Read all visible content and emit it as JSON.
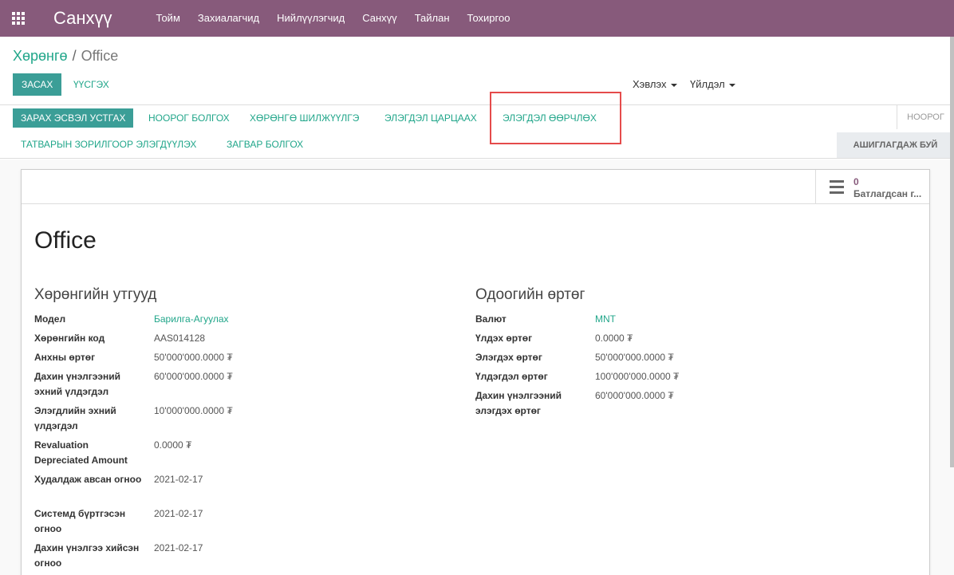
{
  "navbar": {
    "brand": "Санхүү",
    "menu": [
      "Тойм",
      "Захиалагчид",
      "Нийлүүлэгчид",
      "Санхүү",
      "Тайлан",
      "Тохиргоо"
    ]
  },
  "breadcrumb": {
    "parent": "Хөрөнгө",
    "separator": "/",
    "current": "Office"
  },
  "control": {
    "edit_label": "ЗАСАХ",
    "create_label": "ҮҮСГЭХ",
    "print_label": "Хэвлэх",
    "action_label": "Үйлдэл"
  },
  "statusbar": {
    "buttons": [
      "ЗАРАХ ЭСВЭЛ УСТГАХ",
      "НООРОГ БОЛГОХ",
      "ХӨРӨНГӨ ШИЛЖҮҮЛГЭ",
      "ЭЛЭГДЭЛ ЦАРЦААХ",
      "ЭЛЭГДЭЛ ӨӨРЧЛӨХ",
      "ТАТВАРЫН ЗОРИЛГООР ЭЛЭГДҮҮЛЭХ",
      "ЗАГВАР БОЛГОХ"
    ],
    "state_draft": "НООРОГ",
    "state_active": "АШИГЛАГДАЖ БУЙ"
  },
  "smart_button": {
    "value": "0",
    "label": "Батлагдсан г..."
  },
  "record": {
    "title": "Office"
  },
  "left_group": {
    "title": "Хөрөнгийн утгууд",
    "fields": [
      {
        "label": "Модел",
        "value": "Барилга-Агуулах"
      },
      {
        "label": "Хөрөнгийн код",
        "value": "AAS014128"
      },
      {
        "label": "Анхны өртөг",
        "value": "50'000'000.0000 ₮"
      },
      {
        "label": "Дахин үнэлгээний эхний үлдэгдэл",
        "value": "60'000'000.0000 ₮"
      },
      {
        "label": "Элэгдлийн эхний үлдэгдэл",
        "value": "10'000'000.0000 ₮"
      },
      {
        "label": "Revaluation Depreciated Amount",
        "value": "0.0000 ₮"
      },
      {
        "label": "Худалдаж авсан огноо",
        "value": "2021-02-17"
      },
      {
        "label": "Системд бүртгэсэн огноо",
        "value": "2021-02-17"
      },
      {
        "label": "Дахин үнэлгээ хийсэн огноо",
        "value": "2021-02-17"
      }
    ]
  },
  "right_group": {
    "title": "Одоогийн өртөг",
    "fields": [
      {
        "label": "Валют",
        "value": "MNT"
      },
      {
        "label": "Үлдэх өртөг",
        "value": "0.0000 ₮"
      },
      {
        "label": "Элэгдэх өртөг",
        "value": "50'000'000.0000 ₮"
      },
      {
        "label": "Үлдэгдэл өртөг",
        "value": "100'000'000.0000 ₮"
      },
      {
        "label": "Дахин үнэлгээний элэгдэх өртөг",
        "value": "60'000'000.0000 ₮"
      }
    ]
  },
  "colors": {
    "navbar": "#875a7b",
    "primary": "#3b9e97",
    "link": "#21a68a",
    "highlight": "#e54b4b"
  }
}
